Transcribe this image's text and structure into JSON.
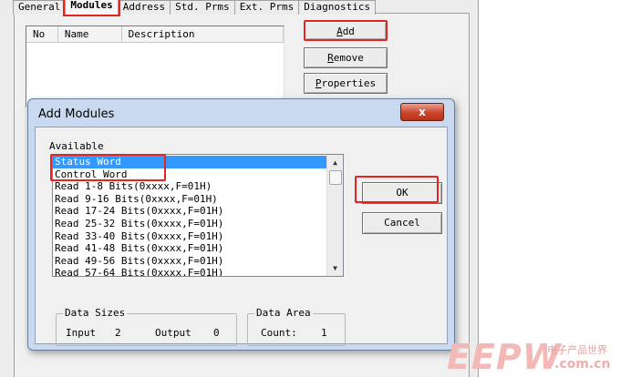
{
  "parent": {
    "tabs": [
      {
        "label": "General"
      },
      {
        "label": "Modules"
      },
      {
        "label": "Address"
      },
      {
        "label": "Std. Prms"
      },
      {
        "label": "Ext. Prms"
      },
      {
        "label": "Diagnostics"
      }
    ],
    "active_tab": "Modules",
    "list_columns": {
      "no": "No",
      "name": "Name",
      "description": "Description"
    },
    "buttons": {
      "add_prefix": "",
      "add_mnemonic": "A",
      "add_rest": "dd",
      "remove_mnemonic": "R",
      "remove_rest": "emove",
      "properties_mnemonic": "P",
      "properties_rest": "roperties"
    }
  },
  "dialog": {
    "title": "Add Modules",
    "close_glyph": "x",
    "available_label": "Available",
    "items": [
      "Status Word",
      "Control Word",
      "Read 1-8 Bits(0xxxx,F=01H)",
      "Read 9-16 Bits(0xxxx,F=01H)",
      "Read 17-24 Bits(0xxxx,F=01H)",
      "Read 25-32 Bits(0xxxx,F=01H)",
      "Read 33-40 Bits(0xxxx,F=01H)",
      "Read 41-48 Bits(0xxxx,F=01H)",
      "Read 49-56 Bits(0xxxx,F=01H)",
      "Read 57-64 Bits(0xxxx,F=01H)"
    ],
    "selected_index": 0,
    "ok_label": "OK",
    "cancel_label": "Cancel",
    "data_sizes": {
      "title": "Data Sizes",
      "input_label": "Input",
      "input_value": "2",
      "output_label": "Output",
      "output_value": "0"
    },
    "data_area": {
      "title": "Data Area",
      "count_label": "Count:",
      "count_value": "1"
    }
  },
  "watermark": {
    "logo_text": "EEPW",
    "tagline": "电子产品世界",
    "url": ".com.cn"
  },
  "colors": {
    "highlight_red": "#e8231f",
    "selection_blue": "#3399ff",
    "dialog_frame": "#c9daf0"
  }
}
